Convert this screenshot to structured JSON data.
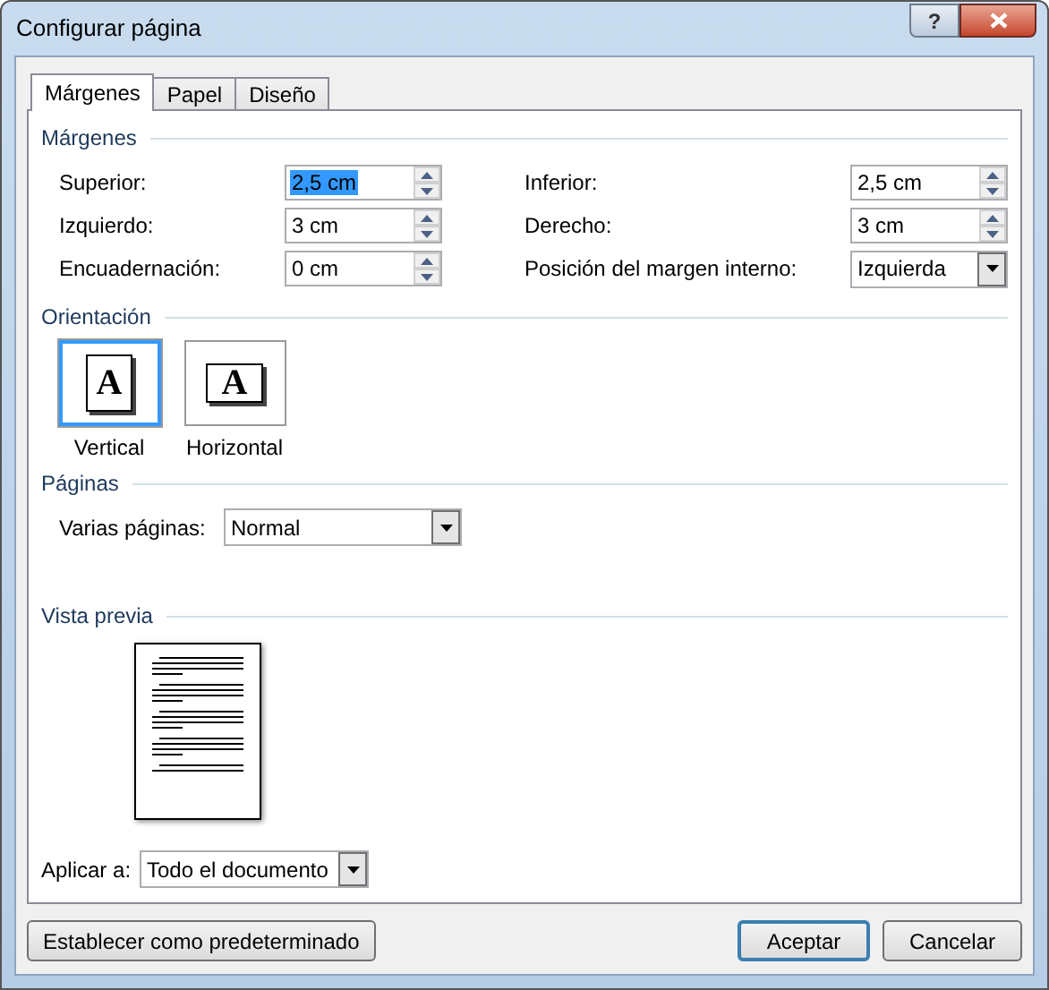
{
  "window": {
    "title": "Configurar página",
    "help_button": "?"
  },
  "tabs": [
    {
      "label": "Márgenes",
      "selected": true
    },
    {
      "label": "Papel",
      "selected": false
    },
    {
      "label": "Diseño",
      "selected": false
    }
  ],
  "margins": {
    "heading": "Márgenes",
    "left_fields": [
      {
        "label": "Superior:",
        "value": "2,5 cm",
        "kind": "spin",
        "text_selected": true
      },
      {
        "label": "Izquierdo:",
        "value": "3 cm",
        "kind": "spin"
      },
      {
        "label": "Encuadernación:",
        "value": "0 cm",
        "kind": "spin"
      }
    ],
    "right_fields": [
      {
        "label": "Inferior:",
        "value": "2,5 cm",
        "kind": "spin"
      },
      {
        "label": "Derecho:",
        "value": "3 cm",
        "kind": "spin"
      },
      {
        "label": "Posición del margen interno:",
        "value": "Izquierda",
        "kind": "dropdown"
      }
    ]
  },
  "orientation": {
    "heading": "Orientación",
    "options": [
      {
        "label": "Vertical",
        "glyph": "A",
        "kind": "portrait",
        "selected": true
      },
      {
        "label": "Horizontal",
        "glyph": "A",
        "kind": "landscape",
        "selected": false
      }
    ]
  },
  "pages": {
    "heading": "Páginas",
    "label": "Varias páginas:",
    "value": "Normal"
  },
  "preview": {
    "heading": "Vista previa"
  },
  "apply_to": {
    "label": "Aplicar a:",
    "value": "Todo el documento"
  },
  "buttons": [
    {
      "label": "Establecer como predeterminado",
      "kind": "left",
      "default": false
    },
    {
      "label": "Aceptar",
      "kind": "right",
      "default": true
    },
    {
      "label": "Cancelar",
      "kind": "right",
      "default": false
    }
  ]
}
